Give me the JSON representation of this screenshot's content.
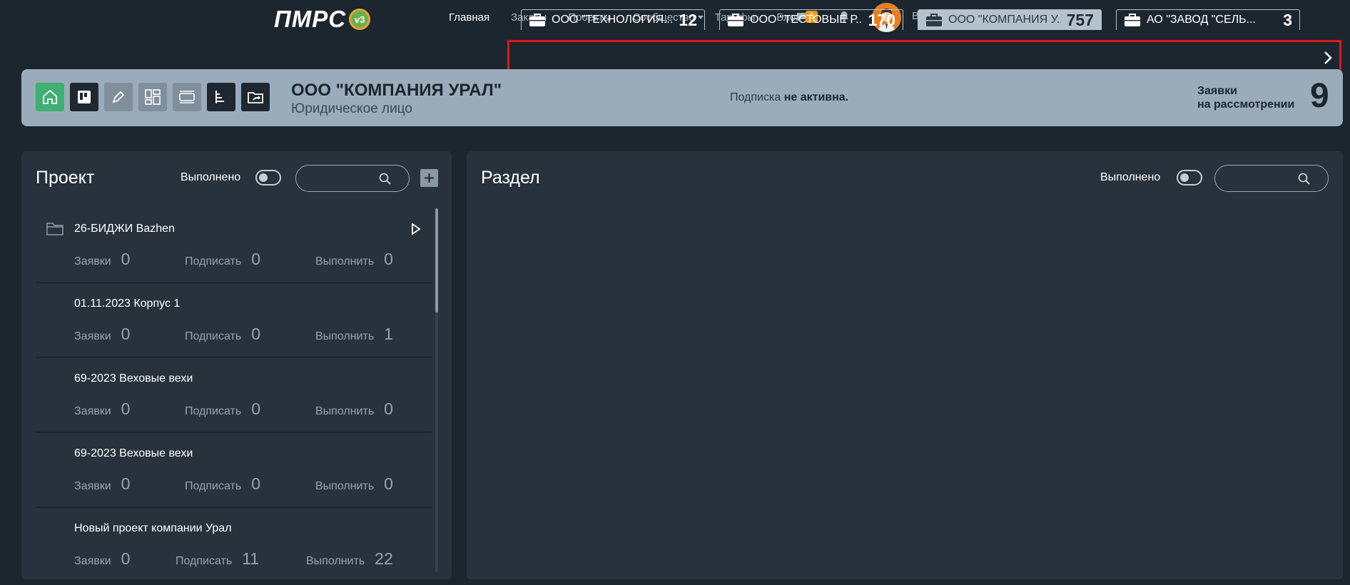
{
  "logo": {
    "text": "ПМРС",
    "badge": "v3"
  },
  "nav": {
    "items": [
      "Главная",
      "Заказы",
      "Проекты",
      "Сообщество",
      "Тарифы",
      "Блог"
    ],
    "chat_count": "3",
    "logout": "Выход"
  },
  "company_tabs": [
    {
      "name": "ООО \"ТЕХНОЛОГИЯ...",
      "count": "12",
      "active": false
    },
    {
      "name": "ООО \"ТЕСТОВЫЕ Р...",
      "count": "170",
      "active": false
    },
    {
      "name": "ООО \"КОМПАНИЯ У...",
      "count": "757",
      "active": true
    },
    {
      "name": "АО \"ЗАВОД \"СЕЛЬ...",
      "count": "3",
      "active": false
    }
  ],
  "company": {
    "name": "ООО \"КОМПАНИЯ УРАЛ\"",
    "type": "Юридическое лицо",
    "subscription_prefix": "Подписка",
    "subscription_status": "не активна.",
    "requests_label_1": "Заявки",
    "requests_label_2": "на рассмотрении",
    "requests_count": "9"
  },
  "project_panel": {
    "title": "Проект",
    "done_label": "Выполнено",
    "search_placeholder": "",
    "items": [
      {
        "name": "26-БИДЖИ Bazhen",
        "requests_label": "Заявки",
        "requests": "0",
        "sign_label": "Подписать",
        "sign": "0",
        "do_label": "Выполнить",
        "do": "0"
      },
      {
        "name": "01.11.2023 Корпус 1",
        "requests_label": "Заявки",
        "requests": "0",
        "sign_label": "Подписать",
        "sign": "0",
        "do_label": "Выполнить",
        "do": "1"
      },
      {
        "name": "69-2023 Веховые вехи",
        "requests_label": "Заявки",
        "requests": "0",
        "sign_label": "Подписать",
        "sign": "0",
        "do_label": "Выполнить",
        "do": "0"
      },
      {
        "name": "69-2023 Веховые вехи",
        "requests_label": "Заявки",
        "requests": "0",
        "sign_label": "Подписать",
        "sign": "0",
        "do_label": "Выполнить",
        "do": "0"
      },
      {
        "name": "Новый проект компании Урал",
        "requests_label": "Заявки",
        "requests": "0",
        "sign_label": "Подписать",
        "sign": "11",
        "do_label": "Выполнить",
        "do": "22"
      }
    ]
  },
  "section_panel": {
    "title": "Раздел",
    "done_label": "Выполнено",
    "search_placeholder": ""
  },
  "colors": {
    "background": "#1c262f",
    "panel": "#27323c",
    "header_band": "#9aacb9",
    "accent_green": "#3eb073",
    "badge_orange": "#f39c12",
    "highlight_red": "#e3141c"
  }
}
